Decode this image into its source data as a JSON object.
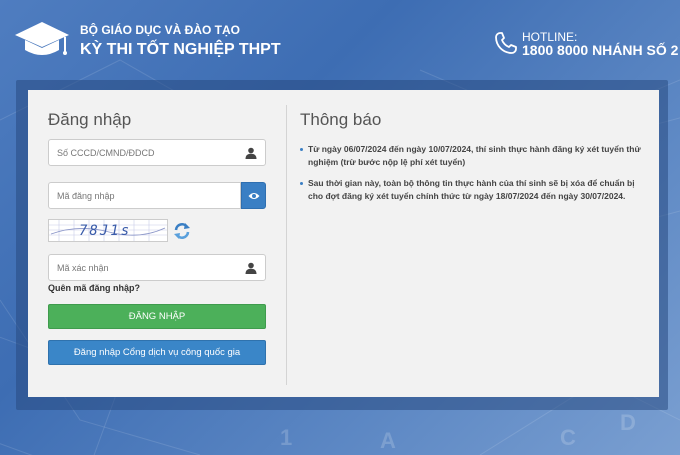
{
  "header": {
    "organization": "BỘ GIÁO DỤC VÀ ĐÀO TẠO",
    "exam_title": "KỲ THI TỐT NGHIỆP THPT",
    "hotline_label": "HOTLINE:",
    "hotline_number": "1800 8000 NHÁNH SỐ 2"
  },
  "login": {
    "title": "Đăng nhập",
    "id_placeholder": "Số CCCD/CMND/ĐDCD",
    "password_placeholder": "Mã đăng nhập",
    "captcha_text": "78J1s",
    "captcha_placeholder": "Mã xác nhận",
    "forgot_link": "Quên mã đăng nhập?",
    "login_button": "ĐĂNG NHẬP",
    "national_portal_button": "Đăng nhập Cổng dịch vụ công quốc gia"
  },
  "notice": {
    "title": "Thông báo",
    "items": [
      "Từ ngày 06/07/2024 đến ngày 10/07/2024, thí sinh thực hành đăng ký xét tuyển thử nghiệm (trừ bước nộp lệ phí xét tuyển)",
      "Sau thời gian này, toàn bộ thông tin thực hành của thí sinh sẽ bị xóa để chuẩn bị cho đợt đăng ký xét tuyển chính thức từ ngày 18/07/2024 đến ngày 30/07/2024."
    ]
  },
  "colors": {
    "login_button": "#4cb05a",
    "national_button": "#3a86c8",
    "eye_button": "#3a7fc4",
    "background": "#4f7dc0"
  }
}
